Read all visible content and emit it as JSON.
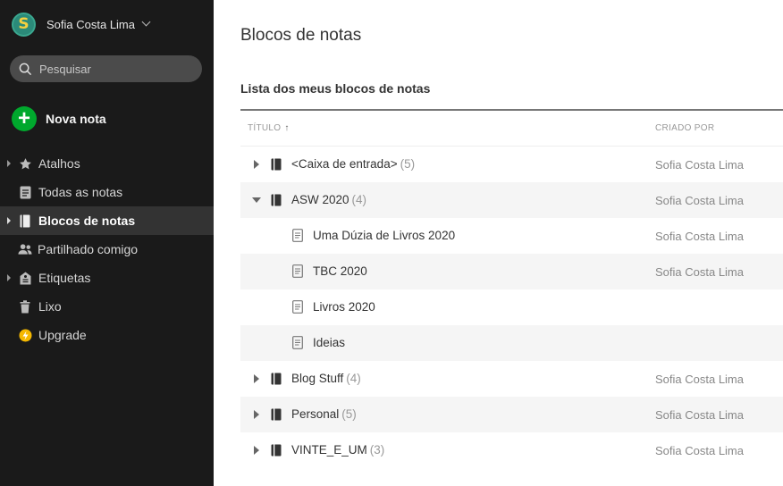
{
  "sidebar": {
    "account": {
      "initial": "S",
      "name": "Sofia Costa Lima"
    },
    "search": {
      "placeholder": "Pesquisar"
    },
    "new_note_label": "Nova nota",
    "items": [
      {
        "label": "Atalhos",
        "icon": "star-icon"
      },
      {
        "label": "Todas as notas",
        "icon": "notes-icon"
      },
      {
        "label": "Blocos de notas",
        "icon": "notebook-icon"
      },
      {
        "label": "Partilhado comigo",
        "icon": "people-icon"
      },
      {
        "label": "Etiquetas",
        "icon": "tag-icon"
      },
      {
        "label": "Lixo",
        "icon": "trash-icon"
      },
      {
        "label": "Upgrade",
        "icon": "lightning-icon"
      }
    ]
  },
  "main": {
    "title": "Blocos de notas",
    "section_title": "Lista dos meus blocos de notas",
    "columns": {
      "title": "TÍTULO",
      "created_by": "CRIADO POR"
    },
    "rows": [
      {
        "name": "<Caixa de entrada>",
        "count": "(5)",
        "creator": "Sofia Costa Lima"
      },
      {
        "name": "ASW 2020",
        "count": "(4)",
        "creator": "Sofia Costa Lima"
      },
      {
        "name": "Uma Dúzia de Livros 2020",
        "count": "",
        "creator": "Sofia Costa Lima"
      },
      {
        "name": "TBC 2020",
        "count": "",
        "creator": "Sofia Costa Lima"
      },
      {
        "name": "Livros 2020",
        "count": "",
        "creator": ""
      },
      {
        "name": "Ideias",
        "count": "",
        "creator": ""
      },
      {
        "name": "Blog Stuff",
        "count": "(4)",
        "creator": "Sofia Costa Lima"
      },
      {
        "name": "Personal",
        "count": "(5)",
        "creator": "Sofia Costa Lima"
      },
      {
        "name": "VINTE_E_UM",
        "count": "(3)",
        "creator": "Sofia Costa Lima"
      }
    ]
  },
  "colors": {
    "accent_green": "#00a82d",
    "sidebar_bg": "#1a1a1a",
    "active_bg": "#333333"
  }
}
